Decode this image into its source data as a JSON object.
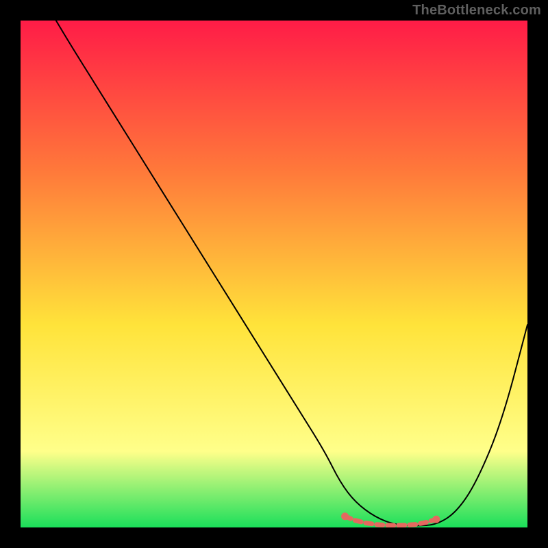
{
  "brand": {
    "watermark": "TheBottleneck.com"
  },
  "chart_data": {
    "type": "line",
    "title": "",
    "xlabel": "",
    "ylabel": "",
    "xlim": [
      0,
      100
    ],
    "ylim": [
      0,
      100
    ],
    "grid": false,
    "legend": false,
    "background_gradient": {
      "top": "#ff1c47",
      "mid1": "#ff7a3a",
      "mid2": "#ffe33a",
      "low": "#ffff8a",
      "bottom": "#1adf5a"
    },
    "series": [
      {
        "name": "bottleneck-curve",
        "x": [
          7,
          10,
          15,
          20,
          25,
          30,
          35,
          40,
          45,
          50,
          55,
          60,
          63,
          66,
          70,
          74,
          78,
          82,
          86,
          90,
          95,
          100
        ],
        "values": [
          100,
          95,
          87,
          79,
          71,
          63,
          55,
          47,
          39,
          31,
          23,
          15,
          9,
          5,
          2,
          0.5,
          0.3,
          0.5,
          3,
          9,
          21,
          40
        ],
        "stroke": "#000000",
        "stroke_width": 2
      }
    ],
    "optimal_markers": {
      "name": "optimal-range",
      "color": "#e4695f",
      "points_x": [
        64,
        66,
        68,
        70,
        72,
        74,
        76,
        78,
        80,
        82
      ],
      "points_y": [
        2.2,
        1.4,
        0.9,
        0.6,
        0.45,
        0.4,
        0.45,
        0.6,
        1.0,
        1.6
      ]
    }
  }
}
